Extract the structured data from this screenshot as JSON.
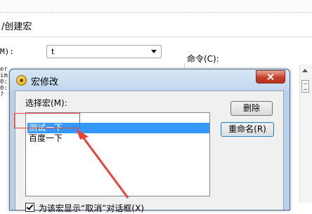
{
  "background_window": {
    "title": "/创建宏",
    "macro_name_label": "M):",
    "macro_name_value": "t",
    "commands_label": "命令(C):",
    "list_fragment": "er\nim\n0:\n0:\n?"
  },
  "dialog": {
    "title": "宏修改",
    "select_macro_label": "选择宏(M):",
    "macros": [
      "测试一下",
      "百度一下"
    ],
    "selected_index": 0,
    "delete_button": "删除",
    "rename_button": "重命名(R)",
    "cancel_checkbox_label": "为该宏显示“取消”对话框(X)",
    "cancel_checkbox_checked": true
  },
  "annotation": {
    "color": "#e8433b"
  }
}
